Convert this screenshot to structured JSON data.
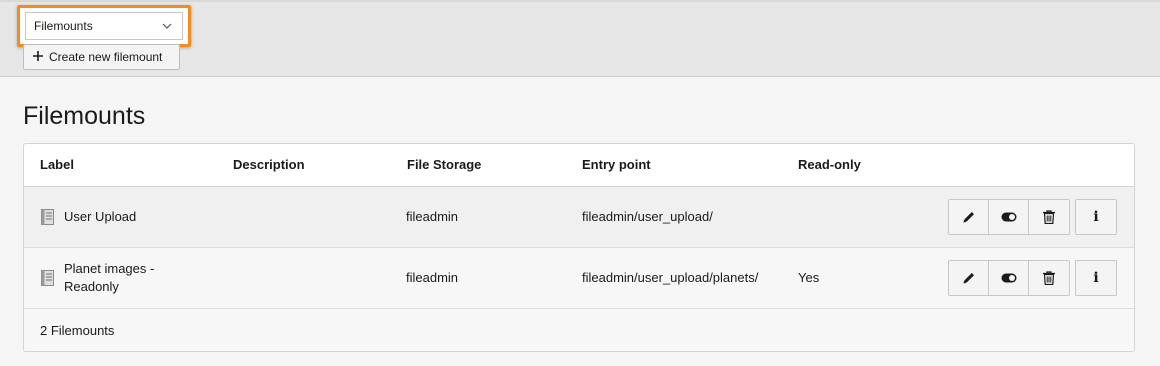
{
  "toolbar": {
    "selector_value": "Filemounts",
    "create_button_label": "Create new filemount",
    "highlight_color": "#f28c20"
  },
  "main": {
    "title": "Filemounts",
    "columns": [
      "Label",
      "Description",
      "File Storage",
      "Entry point",
      "Read-only"
    ],
    "rows": [
      {
        "label": "User Upload",
        "description": "",
        "storage": "fileadmin",
        "entry_point": "fileadmin/user_upload/",
        "read_only": ""
      },
      {
        "label": "Planet images - Readonly",
        "description": "",
        "storage": "fileadmin",
        "entry_point": "fileadmin/user_upload/planets/",
        "read_only": "Yes"
      }
    ],
    "footer": "2 Filemounts"
  },
  "icons": {
    "row_icon": "document-icon",
    "edit": "pencil-icon",
    "toggle": "toggle-icon",
    "delete": "trash-icon",
    "info": "info-icon"
  }
}
